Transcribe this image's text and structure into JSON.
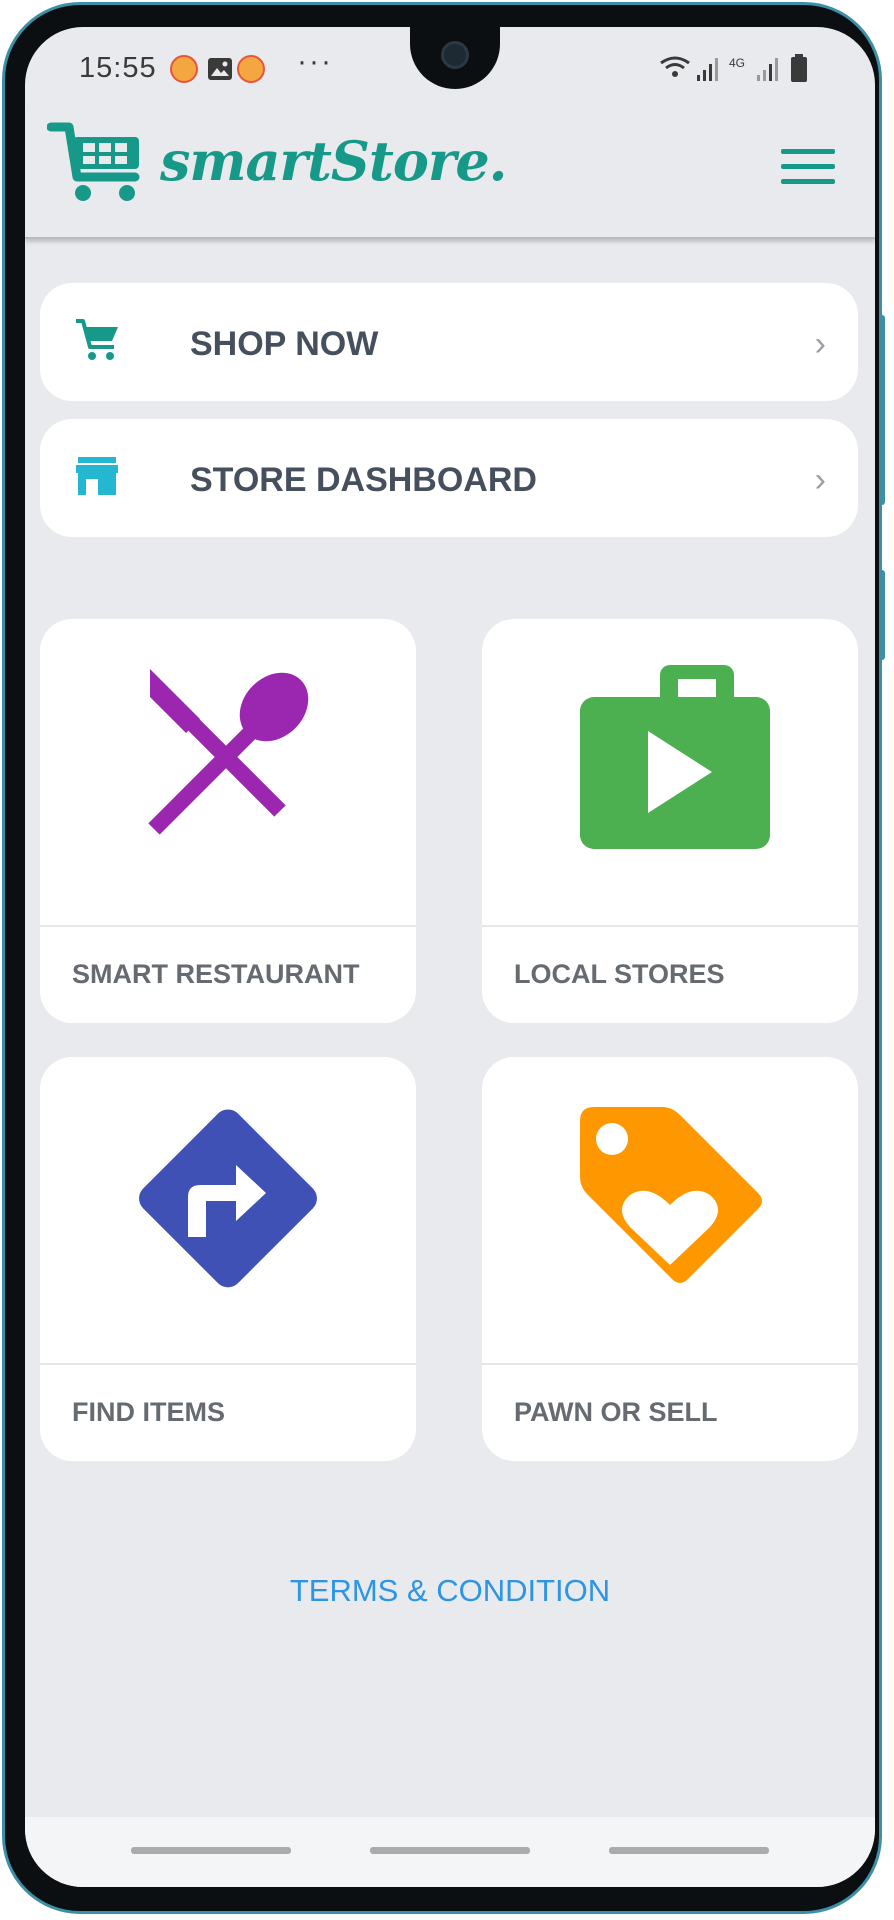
{
  "status_bar": {
    "time": "15:55",
    "more": "···",
    "network": "4G"
  },
  "app_bar": {
    "logo": "smartStore."
  },
  "menu_rows": [
    {
      "label": "SHOP NOW",
      "icon": "cart-icon",
      "color": "#17998a"
    },
    {
      "label": "STORE DASHBOARD",
      "icon": "store-icon",
      "color": "#25b6d2"
    }
  ],
  "tiles": [
    {
      "label": "SMART RESTAURANT",
      "icon": "restaurant-icon",
      "color": "#9b27b0"
    },
    {
      "label": "LOCAL STORES",
      "icon": "shop-bag-icon",
      "color": "#4caf50"
    },
    {
      "label": "FIND ITEMS",
      "icon": "directions-icon",
      "color": "#3f51b5"
    },
    {
      "label": "PAWN OR SELL",
      "icon": "tag-heart-icon",
      "color": "#ff9800"
    }
  ],
  "footer": {
    "terms": "TERMS & CONDITION"
  }
}
